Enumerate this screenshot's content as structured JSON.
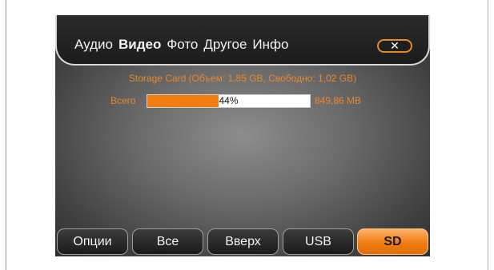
{
  "tabs": [
    {
      "label": "Аудио",
      "active": false
    },
    {
      "label": "Видео",
      "active": true
    },
    {
      "label": "Фото",
      "active": false
    },
    {
      "label": "Другое",
      "active": false
    },
    {
      "label": "Инфо",
      "active": false
    }
  ],
  "close_label": "✕",
  "storage": {
    "info": "Storage Card (Объем: 1,85 GB, Свободно: 1,02 GB)",
    "total_label": "Всего",
    "used_fraction": 0.44,
    "percent_text": "44%",
    "size_text": "849,86 MB"
  },
  "buttons": [
    {
      "label": "Опции",
      "active": false
    },
    {
      "label": "Все",
      "active": false
    },
    {
      "label": "Вверх",
      "active": false
    },
    {
      "label": "USB",
      "active": false
    },
    {
      "label": "SD",
      "active": true
    }
  ],
  "colors": {
    "accent": "#f07d12",
    "info_text": "#e8862e"
  }
}
